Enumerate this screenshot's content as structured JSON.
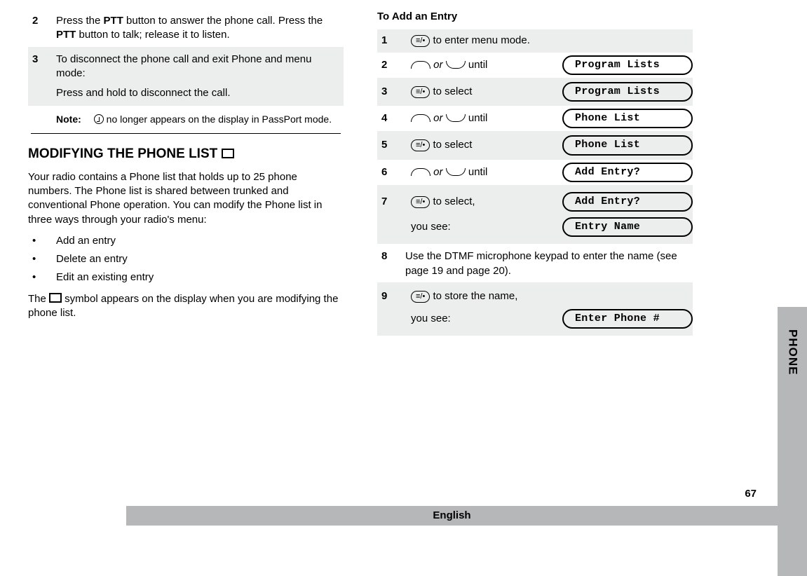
{
  "left": {
    "step2_num": "2",
    "step2_text_a": "Press the ",
    "step2_ptt1": "PTT",
    "step2_text_b": " button to answer the phone call. Press the ",
    "step2_ptt2": "PTT",
    "step2_text_c": " button to talk; release it to listen.",
    "step3_num": "3",
    "step3_l1": "To disconnect the phone call and exit Phone and menu mode:",
    "step3_l2": "Press and hold to disconnect the call.",
    "note_label": "Note:",
    "note_text": " no longer appears on the display in PassPort mode.",
    "heading": "MODIFYING THE PHONE LIST ",
    "para1": "Your radio contains a Phone list that holds up to 25 phone numbers. The Phone list is shared between trunked and conventional Phone operation. You can modify the Phone list in three ways through your radio's menu:",
    "b1": "Add an entry",
    "b2": "Delete an entry",
    "b3": "Edit an existing entry",
    "para2a": "The ",
    "para2b": " symbol appears on the display when you are modifying the phone list."
  },
  "right": {
    "heading": "To Add an Entry",
    "r1_num": "1",
    "r1_text": " to enter menu mode.",
    "r2_num": "2",
    "r2_text": " until",
    "r2_or": " or ",
    "r2_lcd": "Program Lists",
    "r3_num": "3",
    "r3_text": " to select",
    "r3_lcd": "Program Lists",
    "r4_num": "4",
    "r4_text": " until",
    "r4_or": " or ",
    "r4_lcd": "Phone List",
    "r5_num": "5",
    "r5_text": " to select",
    "r5_lcd": "Phone List",
    "r6_num": "6",
    "r6_text": " until",
    "r6_or": " or ",
    "r6_lcd": "Add Entry?",
    "r7_num": "7",
    "r7_text": " to select,",
    "r7_lcd1": "Add Entry?",
    "r7_sub": "you see:",
    "r7_lcd2": "Entry Name",
    "r8_num": "8",
    "r8_text": "Use the DTMF microphone keypad to enter the name (see page 19 and page 20).",
    "r9_num": "9",
    "r9_text": " to store the name,",
    "r9_sub": "you see:",
    "r9_lcd": "Enter Phone #"
  },
  "tab": "PHONE",
  "page_number": "67",
  "language": "English"
}
